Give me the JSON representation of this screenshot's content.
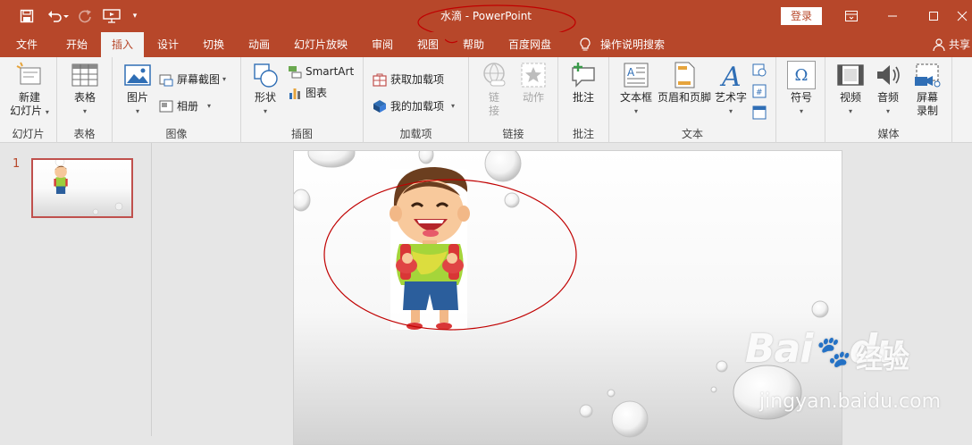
{
  "window": {
    "title": "水滴  -  PowerPoint",
    "login_label": "登录",
    "share_label": "共享"
  },
  "tabs": [
    {
      "label": "文件"
    },
    {
      "label": "开始"
    },
    {
      "label": "插入"
    },
    {
      "label": "设计"
    },
    {
      "label": "切换"
    },
    {
      "label": "动画"
    },
    {
      "label": "幻灯片放映"
    },
    {
      "label": "审阅"
    },
    {
      "label": "视图"
    },
    {
      "label": "帮助"
    },
    {
      "label": "百度网盘"
    },
    {
      "label": "操作说明搜索"
    }
  ],
  "active_tab": "插入",
  "ribbon": {
    "slides": {
      "new_slide_line1": "新建",
      "new_slide_line2": "幻灯片",
      "group": "幻灯片"
    },
    "tables": {
      "table": "表格",
      "group": "表格"
    },
    "images": {
      "picture": "图片",
      "screenshot": "屏幕截图",
      "album": "相册",
      "group": "图像"
    },
    "illustrations": {
      "shapes": "形状",
      "smartart": "SmartArt",
      "chart": "图表",
      "group": "插图"
    },
    "addins": {
      "get": "获取加载项",
      "mine": "我的加载项",
      "group": "加载项"
    },
    "links": {
      "link_line1": "链",
      "link_line2": "接",
      "action": "动作",
      "group": "链接"
    },
    "comments": {
      "comment": "批注",
      "group": "批注"
    },
    "text": {
      "textbox": "文本框",
      "header_footer": "页眉和页脚",
      "wordart": "艺术字",
      "group": "文本"
    },
    "symbols": {
      "symbol": "符号",
      "symbol_glyph": "Ω"
    },
    "media": {
      "video": "视频",
      "audio": "音频",
      "record_line1": "屏幕",
      "record_line2": "录制",
      "group": "媒体"
    }
  },
  "slides_pane": {
    "slide_number": "1"
  },
  "watermark": {
    "brand": "Bai",
    "paw": "🐾",
    "brand_end": "du",
    "cn": "经验",
    "url": "jingyan.baidu.com"
  },
  "colors": {
    "accent": "#b7472a",
    "annotation": "#c00000"
  }
}
